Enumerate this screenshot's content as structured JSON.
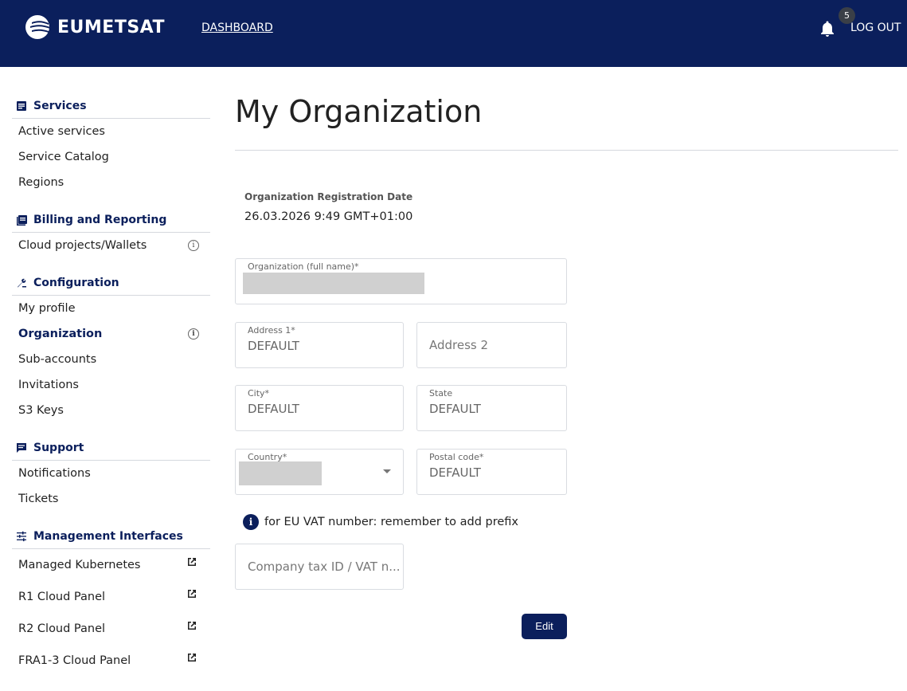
{
  "header": {
    "brand": "EUMETSAT",
    "nav_dashboard": "DASHBOARD",
    "notification_count": "5",
    "logout": "LOG OUT",
    "colors": {
      "topbar": "#0b1f5c",
      "accent": "#0b1f5c"
    }
  },
  "sidebar": {
    "sections": [
      {
        "title": "Services",
        "icon": "list-icon",
        "items": [
          "Active services",
          "Service Catalog",
          "Regions"
        ]
      },
      {
        "title": "Billing and Reporting",
        "icon": "book-icon",
        "items": [
          "Cloud projects/Wallets"
        ]
      },
      {
        "title": "Configuration",
        "icon": "wrench-icon",
        "items": [
          "My profile",
          "Organization",
          "Sub-accounts",
          "Invitations",
          "S3 Keys"
        ]
      },
      {
        "title": "Support",
        "icon": "chat-icon",
        "items": [
          "Notifications",
          "Tickets"
        ]
      },
      {
        "title": "Management Interfaces",
        "icon": "sliders-icon",
        "items": [
          "Managed Kubernetes",
          "R1 Cloud Panel",
          "R2 Cloud Panel",
          "FRA1-3 Cloud Panel"
        ]
      }
    ],
    "active_item": "Organization"
  },
  "main": {
    "title": "My Organization",
    "reg_date_label": "Organization Registration Date",
    "reg_date_value": "26.03.2026 9:49 GMT+01:00",
    "fields": {
      "org_name_label": "Organization (full name)*",
      "address1_label": "Address 1*",
      "address1_value": "DEFAULT",
      "address2_placeholder": "Address 2",
      "city_label": "City*",
      "city_value": "DEFAULT",
      "state_label": "State",
      "state_value": "DEFAULT",
      "country_label": "Country*",
      "postal_label": "Postal code*",
      "postal_value": "DEFAULT",
      "vat_placeholder": "Company tax ID / VAT n..."
    },
    "vat_note": "for EU VAT number: remember to add prefix",
    "edit_button": "Edit"
  }
}
